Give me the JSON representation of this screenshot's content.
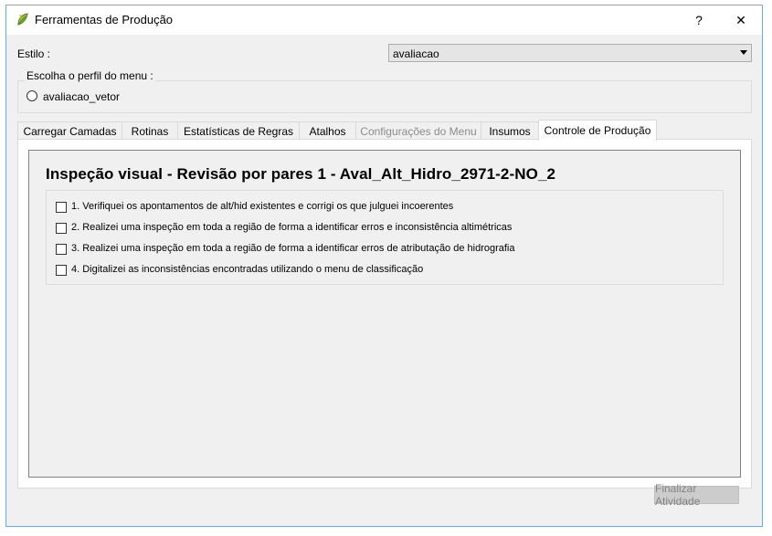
{
  "window": {
    "title": "Ferramentas de Produção",
    "help_label": "?",
    "close_label": "✕"
  },
  "style_field": {
    "label": "Estilo :",
    "value": "avaliacao"
  },
  "menu_profile": {
    "title": "Escolha o perfil do menu :",
    "option": "avaliacao_vetor"
  },
  "tabs": [
    {
      "label": "Carregar Camadas"
    },
    {
      "label": "Rotinas"
    },
    {
      "label": "Estatísticas de Regras"
    },
    {
      "label": "Atalhos"
    },
    {
      "label": "Configurações do Menu"
    },
    {
      "label": "Insumos"
    },
    {
      "label": "Controle de Produção"
    }
  ],
  "content": {
    "heading": "Inspeção visual - Revisão por pares 1 - Aval_Alt_Hidro_2971-2-NO_2",
    "checklist": [
      "1. Verifiquei os apontamentos  de alt/hid existentes e corrigi os que julguei incoerentes",
      "2. Realizei uma inspeção em toda a região de forma a identificar erros e inconsistência altimétricas",
      "3. Realizei uma inspeção em toda a região de forma a identificar erros de atributação de hidrografia",
      "4. Digitalizei as  inconsistências encontradas utilizando o menu de classificação"
    ]
  },
  "footer": {
    "finish_label": "Finalizar Atividade"
  },
  "colors": {
    "tab_disabled": "#8c8c8c",
    "button_disabled_text": "#838383"
  }
}
